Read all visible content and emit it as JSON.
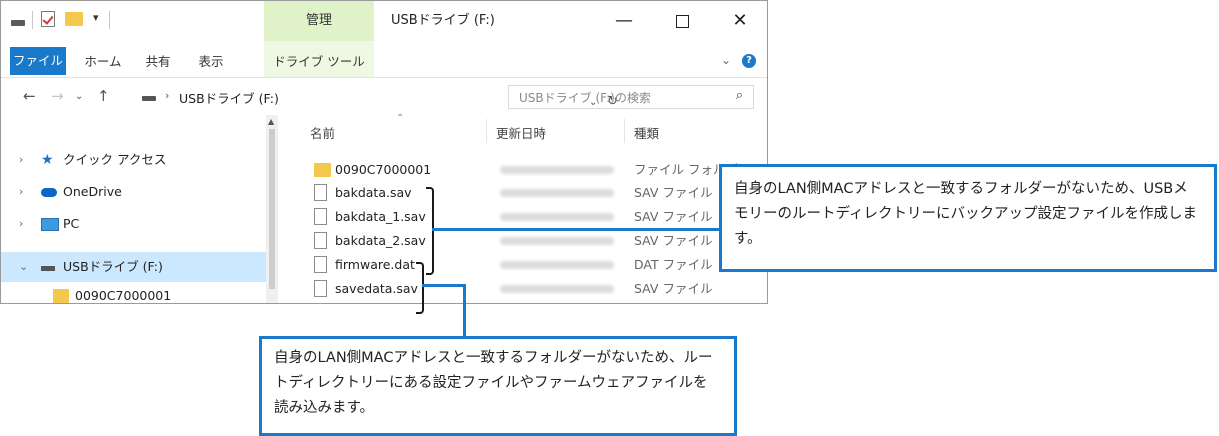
{
  "titlebar": {
    "manage_tab": "管理",
    "window_title": "USBドライブ (F:)",
    "qa_dropdown": "▾"
  },
  "ribbon": {
    "tabs": [
      "ファイル",
      "ホーム",
      "共有",
      "表示",
      "ドライブ ツール"
    ]
  },
  "address": {
    "path": "USBドライブ (F:)",
    "search_placeholder": "USBドライブ (F:)の検索"
  },
  "nav_pane": {
    "items": [
      {
        "label": "クイック アクセス"
      },
      {
        "label": "OneDrive"
      },
      {
        "label": "PC"
      },
      {
        "label": "USBドライブ (F:)"
      },
      {
        "label": "0090C7000001"
      }
    ]
  },
  "columns": {
    "name": "名前",
    "date": "更新日時",
    "type": "種類"
  },
  "files": [
    {
      "name": "0090C7000001",
      "type": "ファイル フォルダー",
      "kind": "folder"
    },
    {
      "name": "bakdata.sav",
      "type": "SAV ファイル",
      "kind": "file"
    },
    {
      "name": "bakdata_1.sav",
      "type": "SAV ファイル",
      "kind": "file"
    },
    {
      "name": "bakdata_2.sav",
      "type": "SAV ファイル",
      "kind": "file"
    },
    {
      "name": "firmware.dat",
      "type": "DAT ファイル",
      "kind": "file"
    },
    {
      "name": "savedata.sav",
      "type": "SAV ファイル",
      "kind": "file"
    }
  ],
  "annotations": {
    "right_text": "自身のLAN側MACアドレスと一致するフォルダーがないため、USBメモリーのルートディレクトリーにバックアップ設定ファイルを作成します。",
    "bottom_text": "自身のLAN側MACアドレスと一致するフォルダーがないため、ルートディレクトリーにある設定ファイルやファームウェアファイルを読み込みます。"
  },
  "colors": {
    "accent": "#1979ca",
    "manage_tab_bg": "#dff2c8",
    "selection": "#cce8ff",
    "folder": "#f2c94c"
  }
}
